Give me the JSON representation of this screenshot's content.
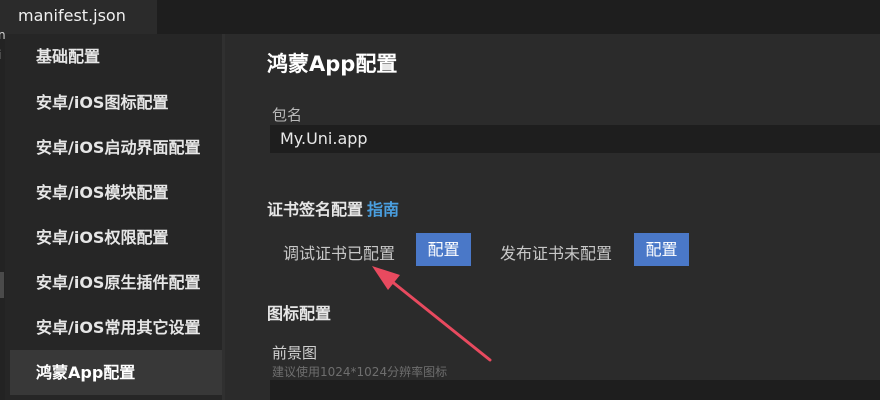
{
  "tab": {
    "title": "manifest.json"
  },
  "gutter": {
    "mark1": "n",
    "mark2": "i"
  },
  "sidebar": {
    "items": [
      {
        "label": "基础配置"
      },
      {
        "label": "安卓/iOS图标配置"
      },
      {
        "label": "安卓/iOS启动界面配置"
      },
      {
        "label": "安卓/iOS模块配置"
      },
      {
        "label": "安卓/iOS权限配置"
      },
      {
        "label": "安卓/iOS原生插件配置"
      },
      {
        "label": "安卓/iOS常用其它设置"
      },
      {
        "label": "鸿蒙App配置"
      }
    ],
    "active_index": 7
  },
  "main": {
    "title": "鸿蒙App配置",
    "package": {
      "label": "包名",
      "value": "My.Uni.app"
    },
    "cert": {
      "title": "证书签名配置",
      "guide": "指南",
      "debug_status": "调试证书已配置",
      "debug_button": "配置",
      "release_status": "发布证书未配置",
      "release_button": "配置"
    },
    "icon": {
      "title": "图标配置",
      "foreground_label": "前景图",
      "foreground_hint": "建议使用1024*1024分辨率图标"
    }
  },
  "colors": {
    "accent_button": "#4a78c8",
    "link": "#4a9fe0",
    "annotation_arrow": "#e84a5f"
  }
}
